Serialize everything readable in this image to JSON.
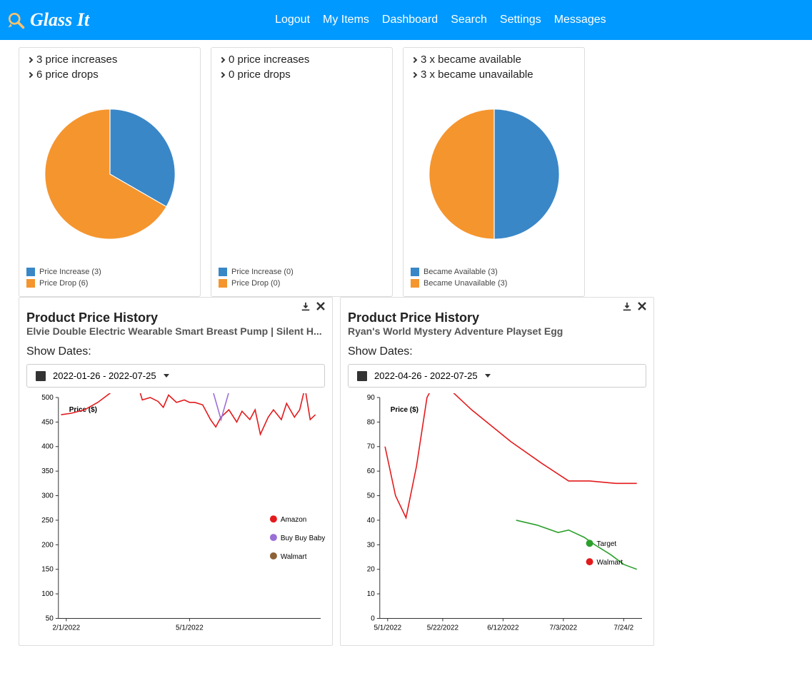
{
  "nav": {
    "brand": "Glass It",
    "links": [
      "Logout",
      "My Items",
      "Dashboard",
      "Search",
      "Settings",
      "Messages"
    ]
  },
  "cards": [
    {
      "stats": [
        "3 price increases",
        "6 price drops"
      ],
      "pie": {
        "slices": [
          {
            "label": "Price Increase",
            "count": 3,
            "color": "#3a87c7"
          },
          {
            "label": "Price Drop",
            "count": 6,
            "color": "#f5952e"
          }
        ]
      }
    },
    {
      "stats": [
        "0 price increases",
        "0 price drops"
      ],
      "pie": {
        "slices": [
          {
            "label": "Price Increase",
            "count": 0,
            "color": "#3a87c7"
          },
          {
            "label": "Price Drop",
            "count": 0,
            "color": "#f5952e"
          }
        ]
      }
    },
    {
      "stats": [
        "3 x became available",
        "3 x became unavailable"
      ],
      "pie": {
        "slices": [
          {
            "label": "Became Available",
            "count": 3,
            "color": "#3a87c7"
          },
          {
            "label": "Became Unavailable",
            "count": 3,
            "color": "#f5952e"
          }
        ]
      }
    }
  ],
  "panels": [
    {
      "title": "Product Price History",
      "subtitle": "Elvie Double Electric Wearable Smart Breast Pump | Silent H...",
      "dates_label": "Show Dates:",
      "date_range": "2022-01-26 - 2022-07-25",
      "chart": {
        "ylabel": "Price ($)",
        "ymin": 50,
        "ymax": 500,
        "ystep": 50,
        "xticks": [
          "2/1/2022",
          "5/1/2022"
        ],
        "xtick_pos": [
          0.03,
          0.5
        ],
        "series": [
          {
            "name": "Amazon",
            "color": "#e31a1c",
            "pts": [
              [
                0.01,
                465
              ],
              [
                0.05,
                468
              ],
              [
                0.1,
                475
              ],
              [
                0.15,
                490
              ],
              [
                0.2,
                510
              ],
              [
                0.25,
                525
              ],
              [
                0.3,
                530
              ],
              [
                0.32,
                495
              ],
              [
                0.35,
                500
              ],
              [
                0.38,
                492
              ],
              [
                0.4,
                480
              ],
              [
                0.42,
                505
              ],
              [
                0.45,
                490
              ],
              [
                0.48,
                495
              ],
              [
                0.5,
                490
              ],
              [
                0.52,
                490
              ],
              [
                0.55,
                485
              ],
              [
                0.58,
                455
              ],
              [
                0.6,
                440
              ],
              [
                0.62,
                460
              ],
              [
                0.65,
                475
              ],
              [
                0.68,
                450
              ],
              [
                0.7,
                472
              ],
              [
                0.73,
                455
              ],
              [
                0.75,
                475
              ],
              [
                0.77,
                425
              ],
              [
                0.8,
                460
              ],
              [
                0.82,
                475
              ],
              [
                0.85,
                455
              ],
              [
                0.87,
                488
              ],
              [
                0.9,
                460
              ],
              [
                0.92,
                475
              ],
              [
                0.94,
                520
              ],
              [
                0.96,
                455
              ],
              [
                0.98,
                465
              ]
            ]
          },
          {
            "name": "Buy Buy Baby",
            "color": "#9a6fd6",
            "pts": [
              [
                0.01,
                530
              ],
              [
                0.35,
                530
              ],
              [
                0.55,
                530
              ],
              [
                0.58,
                530
              ],
              [
                0.62,
                455
              ],
              [
                0.66,
                530
              ],
              [
                0.98,
                530
              ]
            ]
          },
          {
            "name": "Walmart",
            "color": "#8c6239",
            "pts": []
          }
        ],
        "legend_pos": {
          "x": 0.82,
          "y_top": 0.55
        }
      }
    },
    {
      "title": "Product Price History",
      "subtitle": "Ryan's World Mystery Adventure Playset Egg",
      "dates_label": "Show Dates:",
      "date_range": "2022-04-26 - 2022-07-25",
      "chart": {
        "ylabel": "Price ($)",
        "ymin": 0,
        "ymax": 90,
        "ystep": 10,
        "xticks": [
          "5/1/2022",
          "5/22/2022",
          "6/12/2022",
          "7/3/2022",
          "7/24/2"
        ],
        "xtick_pos": [
          0.03,
          0.24,
          0.47,
          0.7,
          0.93
        ],
        "series": [
          {
            "name": "Target",
            "color": "#2ca02c",
            "pts": [
              [
                0.52,
                40
              ],
              [
                0.6,
                38
              ],
              [
                0.68,
                35
              ],
              [
                0.72,
                36
              ],
              [
                0.78,
                33
              ],
              [
                0.82,
                30
              ],
              [
                0.88,
                26
              ],
              [
                0.93,
                22
              ],
              [
                0.98,
                20
              ]
            ]
          },
          {
            "name": "Walmart",
            "color": "#e31a1c",
            "pts": [
              [
                0.02,
                70
              ],
              [
                0.06,
                50
              ],
              [
                0.1,
                41
              ],
              [
                0.14,
                62
              ],
              [
                0.18,
                90
              ],
              [
                0.22,
                98
              ],
              [
                0.35,
                85
              ],
              [
                0.5,
                72
              ],
              [
                0.62,
                63
              ],
              [
                0.72,
                56
              ],
              [
                0.8,
                56
              ],
              [
                0.9,
                55
              ],
              [
                0.98,
                55
              ]
            ]
          }
        ],
        "legend_pos": {
          "x": 0.8,
          "y_top": 0.66
        }
      }
    }
  ],
  "chart_data": [
    {
      "type": "pie",
      "title": "",
      "series": [
        {
          "name": "Price Increase",
          "value": 3
        },
        {
          "name": "Price Drop",
          "value": 6
        }
      ]
    },
    {
      "type": "pie",
      "title": "",
      "series": [
        {
          "name": "Price Increase",
          "value": 0
        },
        {
          "name": "Price Drop",
          "value": 0
        }
      ]
    },
    {
      "type": "pie",
      "title": "",
      "series": [
        {
          "name": "Became Available",
          "value": 3
        },
        {
          "name": "Became Unavailable",
          "value": 3
        }
      ]
    },
    {
      "type": "line",
      "title": "Product Price History — Elvie Double Electric Wearable Smart Breast Pump",
      "xlabel": "",
      "ylabel": "Price ($)",
      "ylim": [
        50,
        530
      ],
      "x": [
        "2022-02-01",
        "2022-02-10",
        "2022-02-19",
        "2022-02-28",
        "2022-03-09",
        "2022-03-18",
        "2022-03-27",
        "2022-04-02",
        "2022-04-07",
        "2022-04-13",
        "2022-04-16",
        "2022-04-20",
        "2022-04-25",
        "2022-04-30",
        "2022-05-04",
        "2022-05-08",
        "2022-05-13",
        "2022-05-18",
        "2022-05-22",
        "2022-05-25",
        "2022-05-30",
        "2022-06-05",
        "2022-06-09",
        "2022-06-14",
        "2022-06-17",
        "2022-06-21",
        "2022-06-26",
        "2022-06-30",
        "2022-07-05",
        "2022-07-08",
        "2022-07-13",
        "2022-07-16",
        "2022-07-20",
        "2022-07-23",
        "2022-07-25"
      ],
      "series": [
        {
          "name": "Amazon",
          "values": [
            465,
            468,
            475,
            490,
            510,
            525,
            530,
            495,
            500,
            492,
            480,
            505,
            490,
            495,
            490,
            490,
            485,
            455,
            440,
            460,
            475,
            450,
            472,
            455,
            475,
            425,
            460,
            475,
            455,
            488,
            460,
            475,
            520,
            455,
            465
          ]
        },
        {
          "name": "Buy Buy Baby",
          "values": [
            530,
            530,
            530,
            530,
            530,
            530,
            530,
            530,
            530,
            530,
            530,
            530,
            530,
            530,
            530,
            530,
            530,
            530,
            455,
            530,
            530,
            530,
            530,
            530,
            530,
            530,
            530,
            530,
            530,
            530,
            530,
            530,
            530,
            530,
            530
          ]
        },
        {
          "name": "Walmart",
          "values": []
        }
      ]
    },
    {
      "type": "line",
      "title": "Product Price History — Ryan's World Mystery Adventure Playset Egg",
      "xlabel": "",
      "ylabel": "Price ($)",
      "ylim": [
        0,
        100
      ],
      "x": [
        "2022-05-01",
        "2022-05-05",
        "2022-05-09",
        "2022-05-13",
        "2022-05-17",
        "2022-05-22",
        "2022-06-03",
        "2022-06-17",
        "2022-06-28",
        "2022-07-08",
        "2022-07-15",
        "2022-07-20",
        "2022-07-25"
      ],
      "series": [
        {
          "name": "Walmart",
          "values": [
            70,
            50,
            41,
            62,
            90,
            98,
            85,
            72,
            63,
            56,
            56,
            55,
            55
          ]
        },
        {
          "name": "Target",
          "values": [
            null,
            null,
            null,
            null,
            null,
            null,
            40,
            38,
            35,
            33,
            30,
            26,
            20
          ]
        }
      ]
    }
  ]
}
